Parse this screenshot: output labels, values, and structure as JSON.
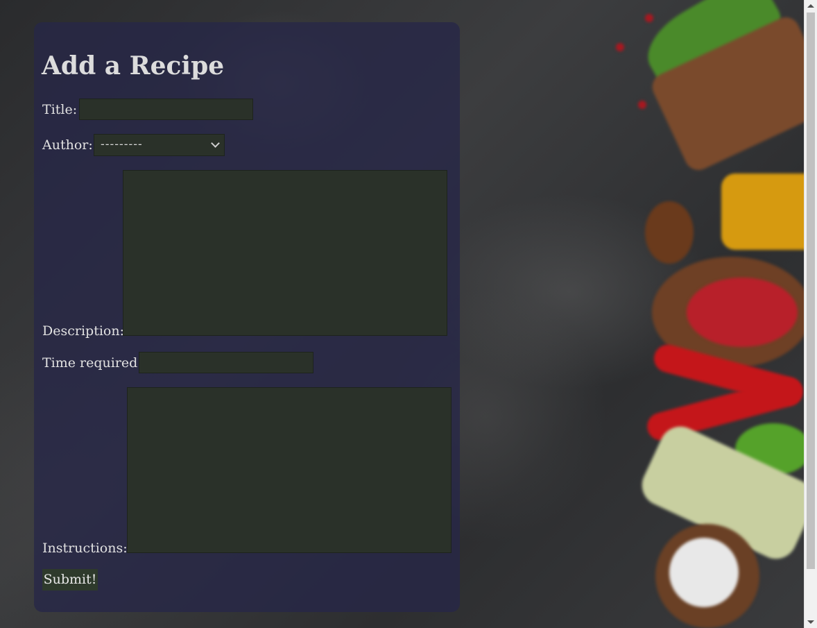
{
  "form": {
    "heading": "Add a Recipe",
    "title_label": "Title:",
    "title_value": "",
    "author_label": "Author:",
    "author_selected": "---------",
    "description_label": "Description:",
    "description_value": "",
    "time_label": "Time required:",
    "time_value": "",
    "instructions_label": "Instructions:",
    "instructions_value": "",
    "submit_label": "Submit!"
  },
  "colors": {
    "panel": "#262648",
    "field": "#2a3129",
    "button": "#2e3a2c"
  }
}
